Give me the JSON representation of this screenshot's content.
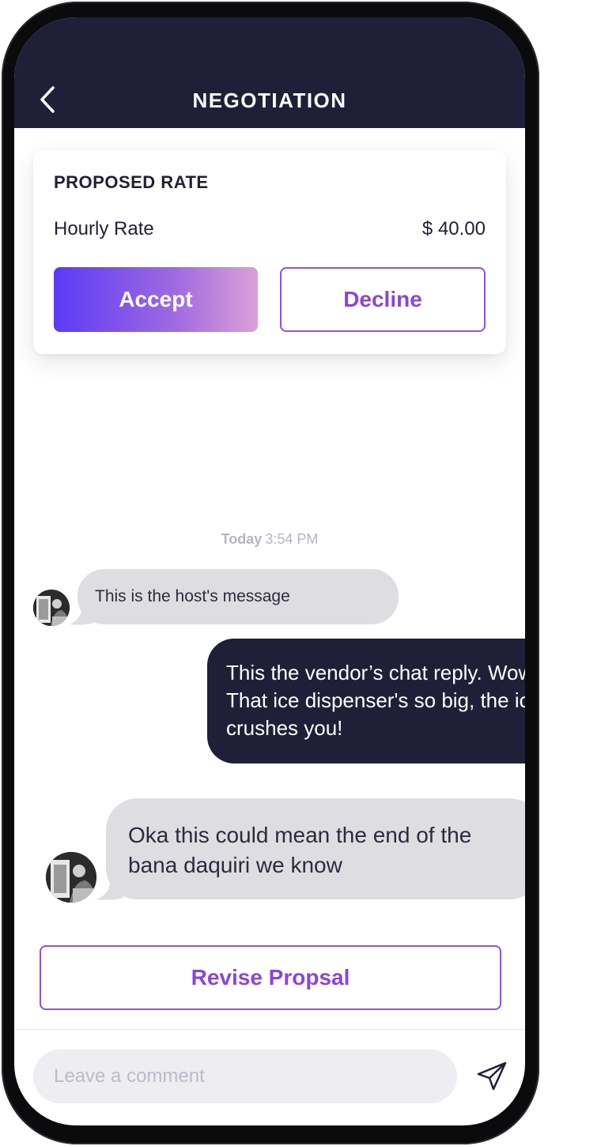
{
  "header": {
    "title": "NEGOTIATION"
  },
  "proposal": {
    "title": "PROPOSED RATE",
    "rate_label": "Hourly Rate",
    "rate_value": "$ 40.00",
    "accept_label": "Accept",
    "decline_label": "Decline"
  },
  "chat": {
    "timestamp_day": "Today",
    "timestamp_time": "3:54 PM",
    "messages": [
      {
        "sender": "host",
        "text": "This is the host's message"
      },
      {
        "sender": "vendor",
        "text": "This the vendor’s chat reply. Wow! That ice dispenser's so big, the  ice crushes you!"
      },
      {
        "sender": "host",
        "text": "Oka this could mean the end of the bana daquiri we know"
      }
    ]
  },
  "actions": {
    "revise_label": "Revise Propsal"
  },
  "composer": {
    "placeholder": "Leave a comment"
  },
  "icons": {
    "back": "chevron-left-icon",
    "send": "send-icon"
  },
  "colors": {
    "header_bg": "#1f2037",
    "accent_purple": "#8c44d8",
    "gradient_start": "#5b3af6",
    "gradient_end": "#dca0d8",
    "bubble_gray": "#dedee2"
  }
}
